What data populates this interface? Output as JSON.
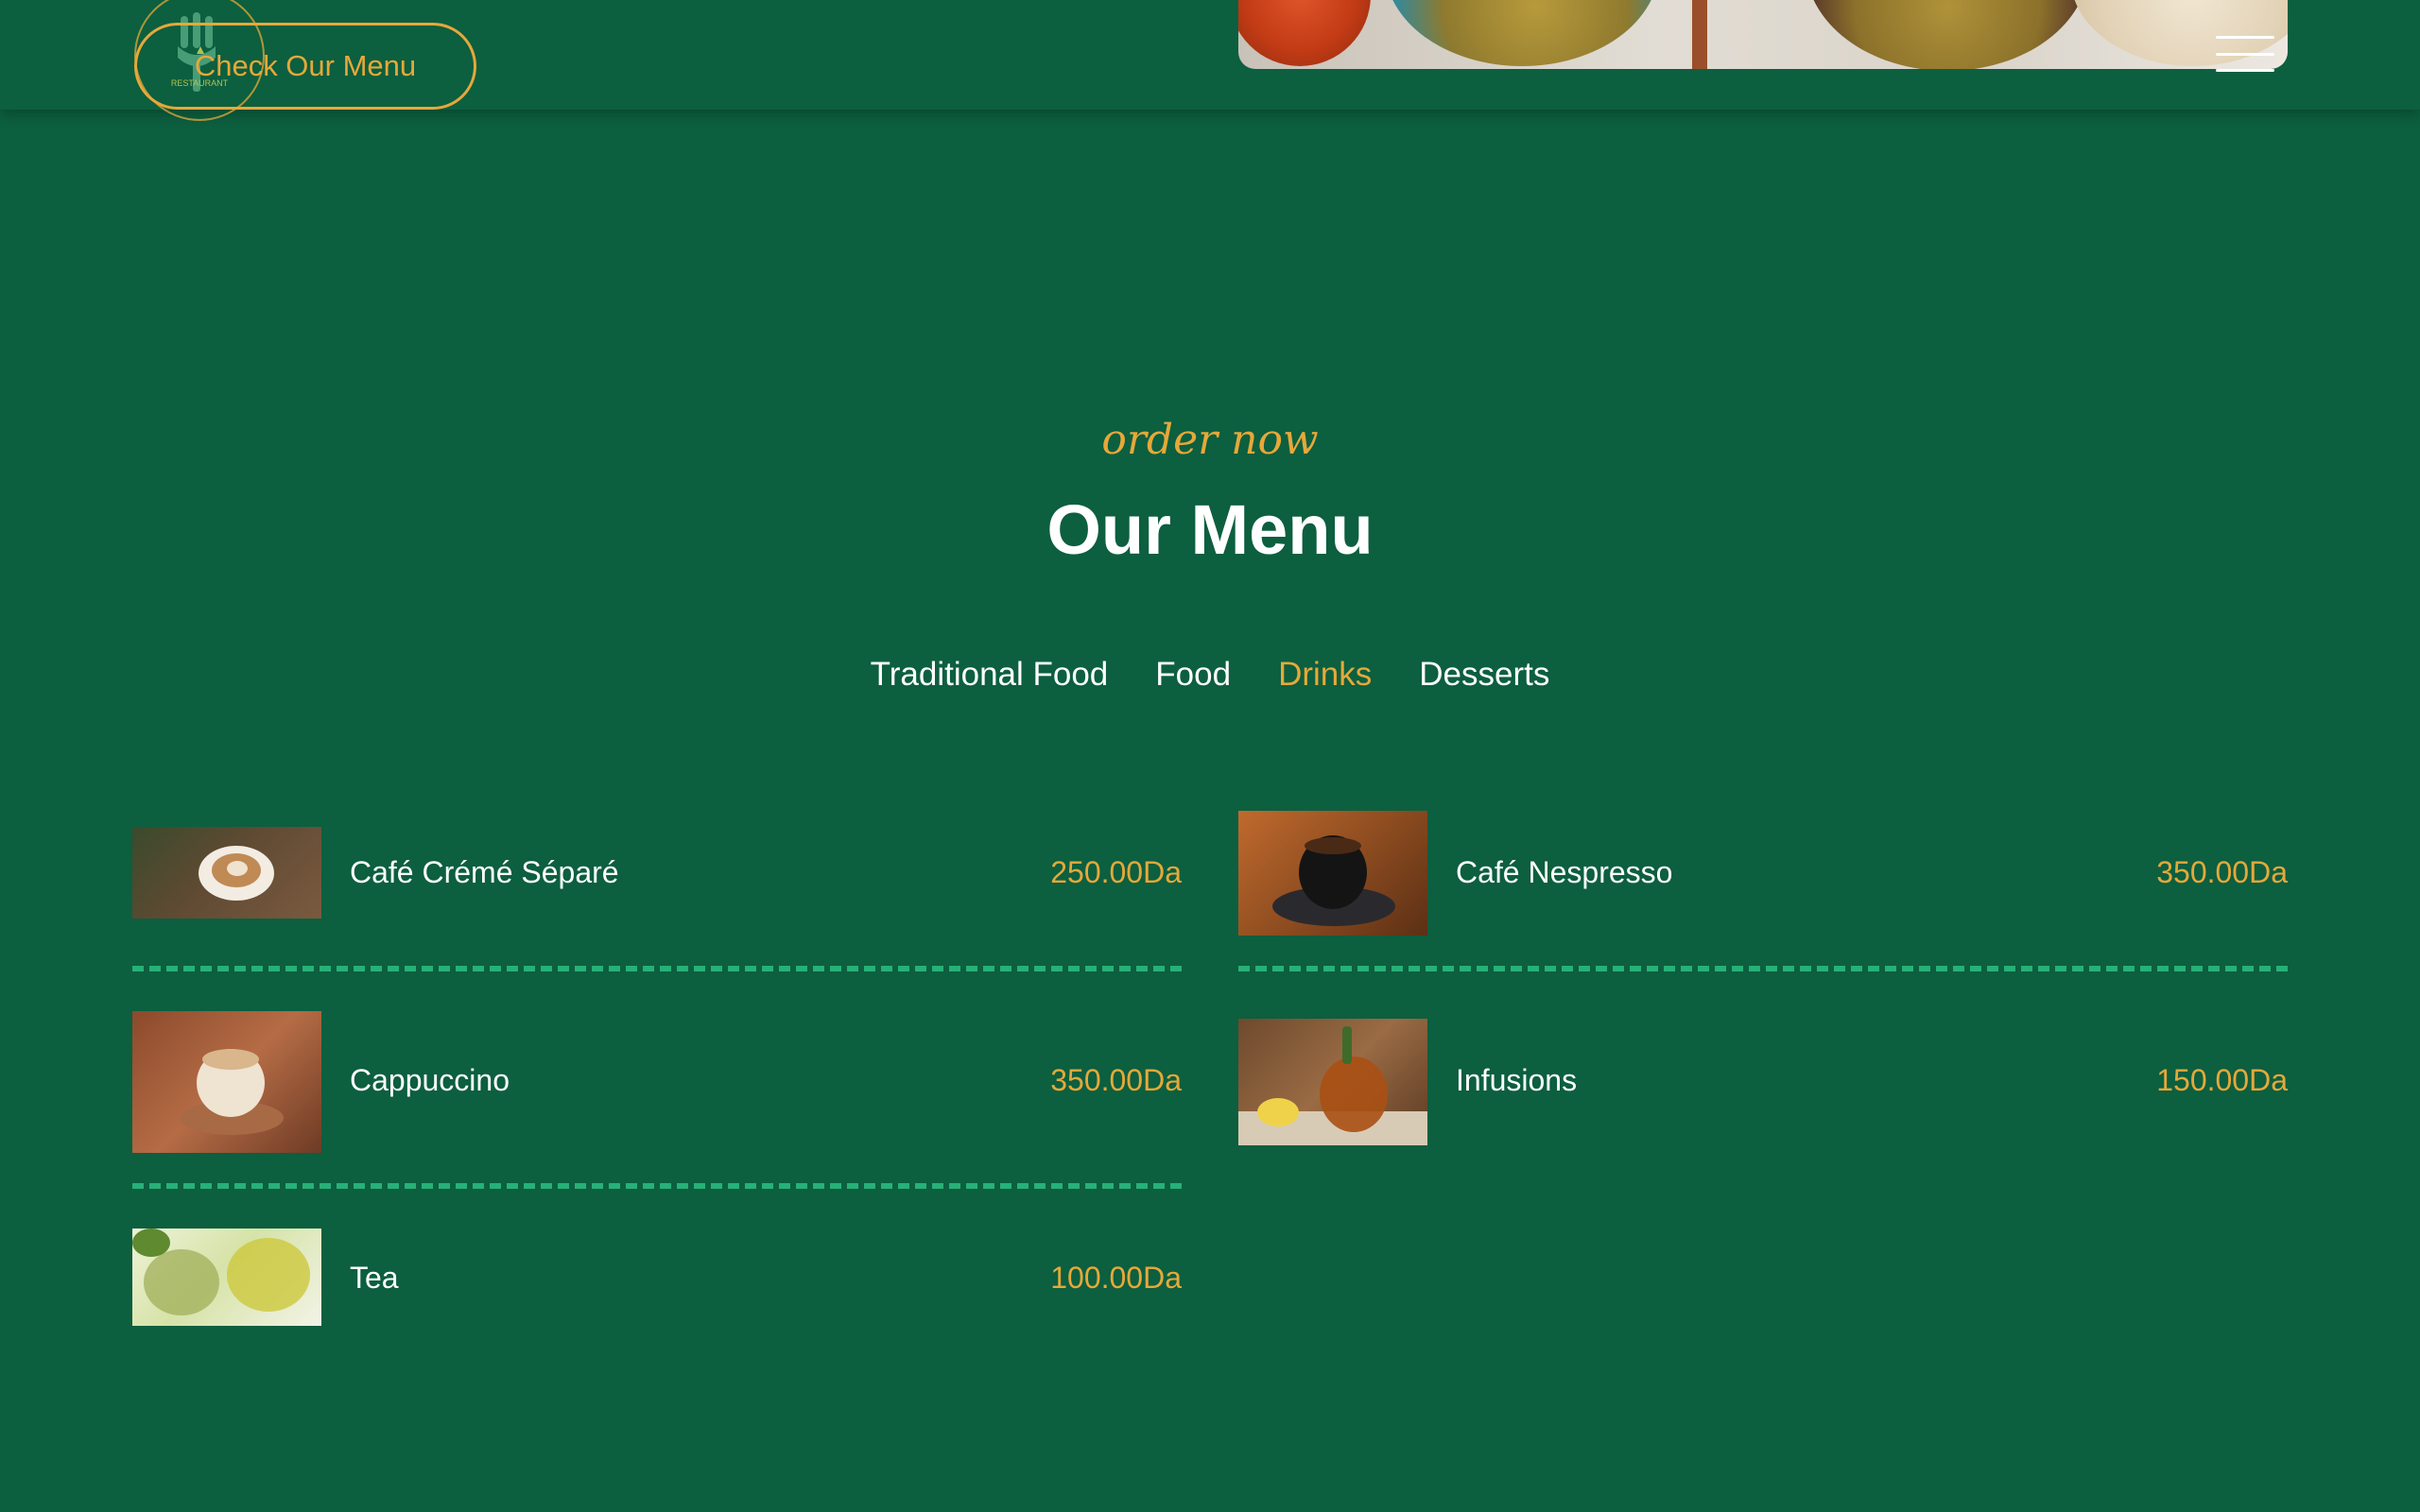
{
  "header": {
    "cta_label": "Check Our Menu",
    "logo_text": "RESTAURANT"
  },
  "section": {
    "subtitle": "order now",
    "title": "Our Menu"
  },
  "tabs": [
    {
      "label": "Traditional Food",
      "active": false
    },
    {
      "label": "Food",
      "active": false
    },
    {
      "label": "Drinks",
      "active": true
    },
    {
      "label": "Desserts",
      "active": false
    }
  ],
  "menu_items": [
    {
      "name": "Café Crémé Séparé",
      "price": "250.00Da",
      "image": "cafe-creme-photo"
    },
    {
      "name": "Café Nespresso",
      "price": "350.00Da",
      "image": "espresso-cup-photo"
    },
    {
      "name": "Cappuccino",
      "price": "350.00Da",
      "image": "cappuccino-photo"
    },
    {
      "name": "Infusions",
      "price": "150.00Da",
      "image": "herbal-tea-photo"
    },
    {
      "name": "Tea",
      "price": "100.00Da",
      "image": "green-tea-photo"
    }
  ],
  "colors": {
    "background": "#0c5f3f",
    "accent": "#e6a83a",
    "separator": "#27b078",
    "text": "#ffffff"
  },
  "icons": {
    "menu": "hamburger-icon",
    "logo": "logo-icon"
  }
}
